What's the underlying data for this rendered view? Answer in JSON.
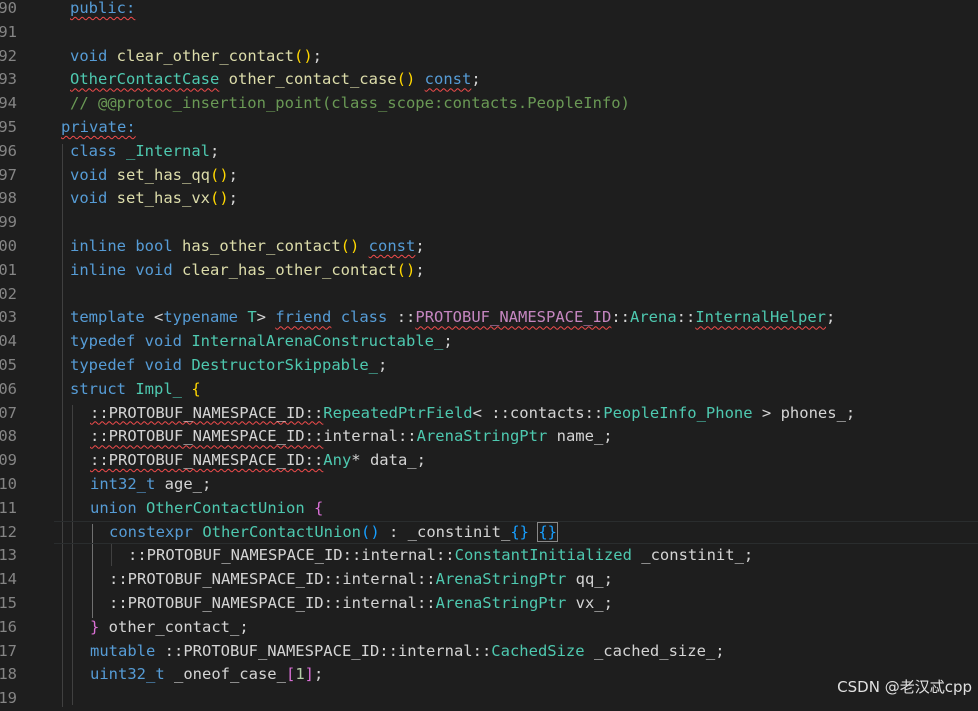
{
  "lines": [
    {
      "n": "90",
      "t": "public:"
    },
    {
      "n": "91",
      "t": ""
    },
    {
      "n": "92",
      "t": "void clear_other_contact();"
    },
    {
      "n": "93",
      "t": "OtherContactCase other_contact_case() const;"
    },
    {
      "n": "94",
      "t": "// @@protoc_insertion_point(class_scope:contacts.PeopleInfo)"
    },
    {
      "n": "95",
      "t": "private:"
    },
    {
      "n": "96",
      "t": "class _Internal;"
    },
    {
      "n": "97",
      "t": "void set_has_qq();"
    },
    {
      "n": "98",
      "t": "void set_has_vx();"
    },
    {
      "n": "99",
      "t": ""
    },
    {
      "n": "00",
      "t": "inline bool has_other_contact() const;"
    },
    {
      "n": "01",
      "t": "inline void clear_has_other_contact();"
    },
    {
      "n": "02",
      "t": ""
    },
    {
      "n": "03",
      "t": "template <typename T> friend class ::PROTOBUF_NAMESPACE_ID::Arena::InternalHelper;"
    },
    {
      "n": "04",
      "t": "typedef void InternalArenaConstructable_;"
    },
    {
      "n": "05",
      "t": "typedef void DestructorSkippable_;"
    },
    {
      "n": "06",
      "t": "struct Impl_ {"
    },
    {
      "n": "07",
      "t": "::PROTOBUF_NAMESPACE_ID::RepeatedPtrField< ::contacts::PeopleInfo_Phone > phones_;"
    },
    {
      "n": "08",
      "t": "::PROTOBUF_NAMESPACE_ID::internal::ArenaStringPtr name_;"
    },
    {
      "n": "09",
      "t": "::PROTOBUF_NAMESPACE_ID::Any* data_;"
    },
    {
      "n": "10",
      "t": "int32_t age_;"
    },
    {
      "n": "11",
      "t": "union OtherContactUnion {"
    },
    {
      "n": "12",
      "t": "constexpr OtherContactUnion() : _constinit_{} {}"
    },
    {
      "n": "13",
      "t": "::PROTOBUF_NAMESPACE_ID::internal::ConstantInitialized _constinit_;"
    },
    {
      "n": "14",
      "t": "::PROTOBUF_NAMESPACE_ID::internal::ArenaStringPtr qq_;"
    },
    {
      "n": "15",
      "t": "::PROTOBUF_NAMESPACE_ID::internal::ArenaStringPtr vx_;"
    },
    {
      "n": "16",
      "t": "} other_contact_;"
    },
    {
      "n": "17",
      "t": "mutable ::PROTOBUF_NAMESPACE_ID::internal::CachedSize _cached_size_;"
    },
    {
      "n": "18",
      "t": "uint32_t _oneof_case_[1];"
    },
    {
      "n": "19",
      "t": ""
    }
  ],
  "watermark": "CSDN @老汉忒cpp"
}
